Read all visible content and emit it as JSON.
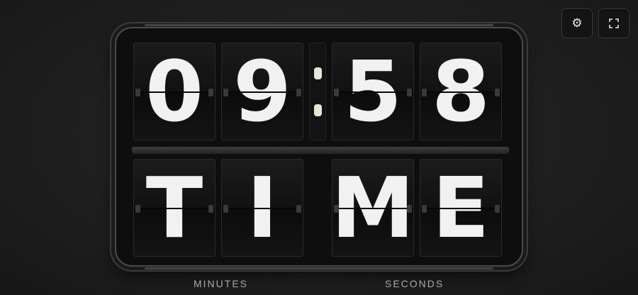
{
  "controls": {
    "settings_icon": "⚙",
    "fullscreen_icon": "fullscreen-corners-icon"
  },
  "board": {
    "time_digits": [
      "0",
      "9",
      "5",
      "8"
    ],
    "word_letters": [
      "T",
      "I",
      "M",
      "E"
    ]
  },
  "captions": {
    "minutes": "MINUTES",
    "seconds": "SECONDS"
  },
  "colors": {
    "background": "#1f1f1f",
    "tile": "#121212",
    "glyph": "#f1f1f1",
    "colon_dot": "#e8e4d6"
  }
}
